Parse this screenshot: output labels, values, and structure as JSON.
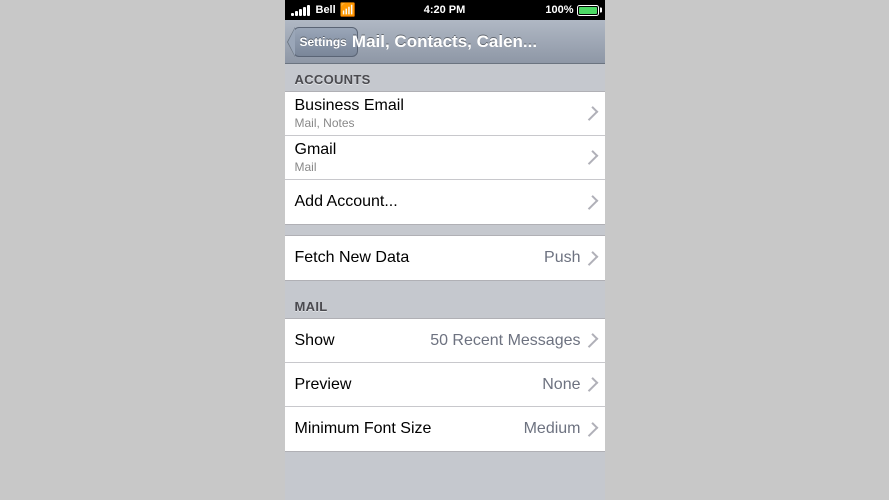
{
  "statusBar": {
    "carrier": "Bell",
    "time": "4:20 PM",
    "battery": "100%"
  },
  "navBar": {
    "backLabel": "Settings",
    "title": "Mail, Contacts, Calen..."
  },
  "sections": [
    {
      "id": "accounts",
      "header": "Accounts",
      "rows": [
        {
          "id": "business-email",
          "title": "Business Email",
          "subtitle": "Mail, Notes",
          "value": "",
          "hasChevron": true
        },
        {
          "id": "gmail",
          "title": "Gmail",
          "subtitle": "Mail",
          "value": "",
          "hasChevron": true
        },
        {
          "id": "add-account",
          "title": "Add Account...",
          "subtitle": "",
          "value": "",
          "hasChevron": true
        }
      ]
    }
  ],
  "singleRows": [
    {
      "id": "fetch-new-data",
      "title": "Fetch New Data",
      "value": "Push",
      "hasChevron": true
    }
  ],
  "mailSection": {
    "header": "Mail",
    "rows": [
      {
        "id": "show",
        "title": "Show",
        "value": "50 Recent Messages",
        "hasChevron": true
      },
      {
        "id": "preview",
        "title": "Preview",
        "value": "None",
        "hasChevron": true
      },
      {
        "id": "minimum-font-size",
        "title": "Minimum Font Size",
        "value": "Medium",
        "hasChevron": true
      }
    ]
  }
}
